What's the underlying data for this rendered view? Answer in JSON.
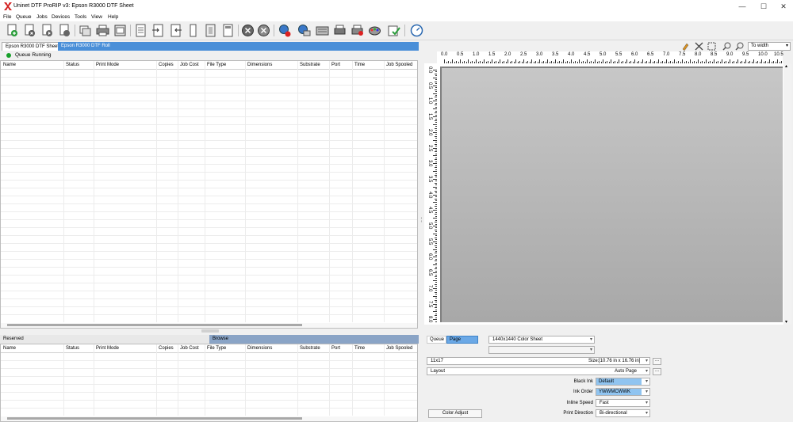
{
  "window": {
    "title": "Uninet DTF ProRIP v3: Epson R3000 DTF Sheet",
    "minimize": "—",
    "maximize": "☐",
    "close": "✕"
  },
  "menu": [
    "File",
    "Queue",
    "Jobs",
    "Devices",
    "Tools",
    "View",
    "Help"
  ],
  "toolbar_icons": [
    "add-job-icon",
    "delete-job-icon",
    "print-job-icon",
    "hold-job-icon",
    "duplicate-job-icon",
    "printer-icon",
    "export-icon",
    "layout-icon",
    "crop-icon",
    "tile-icon",
    "nest-icon",
    "page-icon",
    "stop-icon",
    "cancel-icon",
    "queue-settings-icon",
    "queue-edit-icon",
    "device-settings-icon",
    "printer-setup-icon",
    "printer-maintenance-icon",
    "color-profile-icon",
    "approve-icon",
    "calibrate-icon"
  ],
  "left": {
    "tabs": [
      "Epson R3000 DTF Sheet",
      "Epson R3000 DTF Roll"
    ],
    "status": "Queue Running",
    "columns": [
      "Name",
      "Status",
      "Print Mode",
      "Copies",
      "Job Cost",
      "File Type",
      "Dimensions",
      "Substrate",
      "Port",
      "Time",
      "Job Spooled"
    ],
    "lower_tabs": [
      "Reserved",
      "Browse"
    ]
  },
  "preview": {
    "zoom": "To width",
    "ruler_h": [
      "0.0",
      "0.5",
      "1.0",
      "1.5",
      "2.0",
      "2.5",
      "3.0",
      "3.5",
      "4.0",
      "4.5",
      "5.0",
      "5.5",
      "6.0",
      "6.5",
      "7.0",
      "7.5",
      "8.0",
      "8.5",
      "9.0",
      "9.5",
      "10.0",
      "10.5"
    ],
    "ruler_v": [
      "0.0",
      "0.5",
      "1.0",
      "1.5",
      "2.0",
      "2.5",
      "3.0",
      "3.5",
      "4.0",
      "4.5",
      "5.0",
      "5.5",
      "6.0",
      "6.5",
      "7.0",
      "7.5",
      "8.0"
    ]
  },
  "settings": {
    "tabs": [
      "Queue",
      "Page"
    ],
    "mode": "1440x1440 Color Sheet",
    "mode2": "",
    "size_name": "11x17",
    "size_label": "Size:",
    "size_value": "[10.76 in x 16.76 in]",
    "layout_name": "Layout",
    "layout_value": "Auto Page",
    "black_ink_label": "Black Ink",
    "black_ink": "Default",
    "ink_order_label": "Ink Order",
    "ink_order": "YWWMCWWK",
    "inline_speed_label": "Inline Speed",
    "inline_speed": "Fast",
    "print_direction_label": "Print Direction",
    "print_direction": "Bi-directional",
    "color_adjust": "Color Adjust",
    "dots": "..."
  }
}
